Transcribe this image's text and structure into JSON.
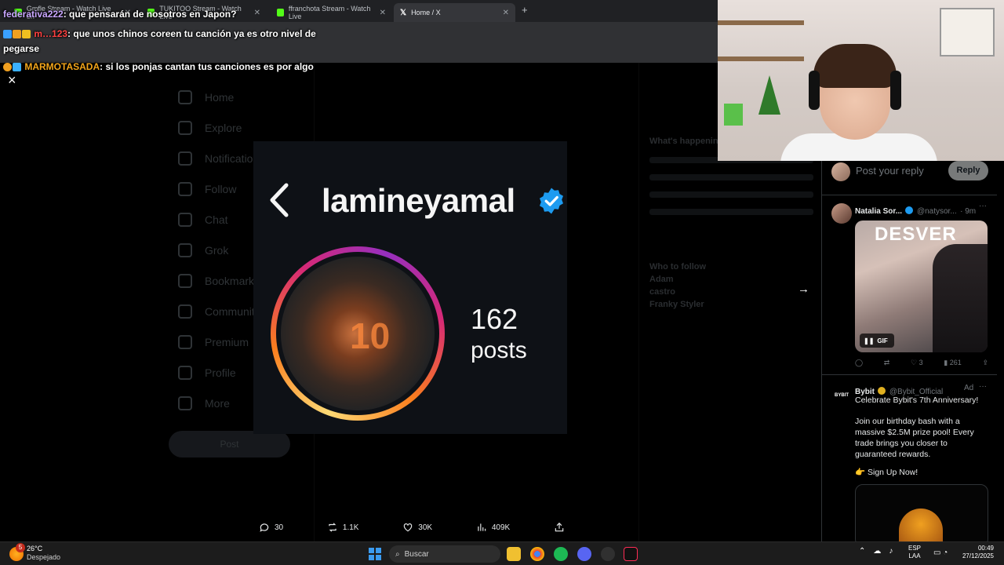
{
  "browser": {
    "tabs": [
      {
        "label": "Gmfle Stream - Watch Live on"
      },
      {
        "label": "TUKITOO Stream - Watch Live"
      },
      {
        "label": "ffranchota Stream - Watch Live"
      },
      {
        "label": "Home / X"
      }
    ],
    "new_tab": "+"
  },
  "chat": [
    {
      "user": "federativa222",
      "text": ": que pensarán de nosotros en Japon?",
      "color": "#c9a6ff"
    },
    {
      "user": "m…123",
      "text": ": que unos chinos coreen tu canción ya es otro nivel de",
      "color": "#ff4040"
    },
    {
      "user": "",
      "text": "pegarse",
      "color": "#ffffff"
    },
    {
      "user": "MARMOTASADA",
      "text": ": si los ponjas cantan tus canciones es por algo",
      "color": "#f2a51a"
    }
  ],
  "x_nav": [
    "Home",
    "Explore",
    "Notifications",
    "Follow",
    "Chat",
    "Grok",
    "Bookmarks",
    "Communities",
    "Premium",
    "Profile",
    "More"
  ],
  "x_post_button": "Post",
  "x_right": {
    "whats_happening": "What's happening",
    "who_to_follow": "Who to follow",
    "follow_label": "Follow",
    "suggestions": [
      "Adam",
      "castro",
      "Franky Styler"
    ]
  },
  "media": {
    "close": "×",
    "handle": "lamineyamal",
    "avatar_number": "10",
    "posts_count": "162",
    "posts_label": "posts"
  },
  "actions": {
    "replies": "30",
    "reposts": "1.1K",
    "likes": "30K",
    "views": "409K"
  },
  "reply_panel": {
    "placeholder": "Post your reply",
    "reply_button": "Reply",
    "reply": {
      "name": "Natalia Sor...",
      "handle": "@natysor...",
      "time": "· 9m",
      "gif_text": "DESVER",
      "gif_label": "GIF",
      "likes": "3",
      "views": "261"
    },
    "ad": {
      "name": "Bybit",
      "handle": "@Bybit_Official",
      "ad_label": "Ad",
      "logo_text": "BYBIT",
      "line1": "Celebrate Bybit's 7th Anniversary!",
      "line2": "Join our birthday bash with a massive $2.5M prize pool! Every trade brings you closer to guaranteed rewards.",
      "line3": "👉 Sign Up Now!"
    }
  },
  "taskbar": {
    "weather_badge": "5",
    "temperature": "26°C",
    "condition": "Despejado",
    "search_placeholder": "Buscar",
    "lang_top": "ESP",
    "lang_bottom": "LAA",
    "time": "00:49",
    "date": "27/12/2025"
  },
  "colors": {
    "verified_blue": "#1d9bf0",
    "story_ring_start": "#feda75",
    "story_ring_mid": "#d62976",
    "story_ring_end": "#962fbf"
  }
}
